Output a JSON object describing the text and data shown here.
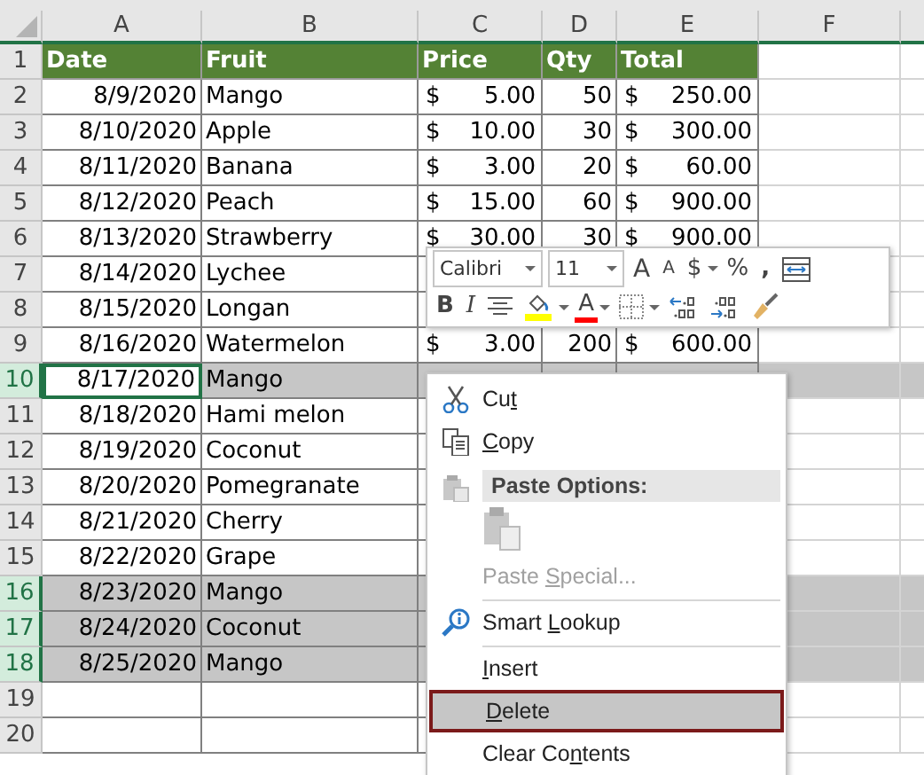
{
  "columns": [
    "A",
    "B",
    "C",
    "D",
    "E",
    "F"
  ],
  "header_row": {
    "number": "1",
    "cells": [
      "Date",
      "Fruit",
      "Price",
      "Qty",
      "Total"
    ]
  },
  "rows": [
    {
      "number": "2",
      "selected": false,
      "active": false,
      "date": "8/9/2020",
      "fruit": "Mango",
      "price_symbol": "$",
      "price": "5.00",
      "qty": "50",
      "total_symbol": "$",
      "total": "250.00"
    },
    {
      "number": "3",
      "selected": false,
      "active": false,
      "date": "8/10/2020",
      "fruit": "Apple",
      "price_symbol": "$",
      "price": "10.00",
      "qty": "30",
      "total_symbol": "$",
      "total": "300.00"
    },
    {
      "number": "4",
      "selected": false,
      "active": false,
      "date": "8/11/2020",
      "fruit": "Banana",
      "price_symbol": "$",
      "price": "3.00",
      "qty": "20",
      "total_symbol": "$",
      "total": "60.00"
    },
    {
      "number": "5",
      "selected": false,
      "active": false,
      "date": "8/12/2020",
      "fruit": "Peach",
      "price_symbol": "$",
      "price": "15.00",
      "qty": "60",
      "total_symbol": "$",
      "total": "900.00"
    },
    {
      "number": "6",
      "selected": false,
      "active": false,
      "date": "8/13/2020",
      "fruit": "Strawberry",
      "price_symbol": "$",
      "price": "30.00",
      "qty": "30",
      "total_symbol": "$",
      "total": "900.00"
    },
    {
      "number": "7",
      "selected": false,
      "active": false,
      "date": "8/14/2020",
      "fruit": "Lychee"
    },
    {
      "number": "8",
      "selected": false,
      "active": false,
      "date": "8/15/2020",
      "fruit": "Longan"
    },
    {
      "number": "9",
      "selected": false,
      "active": false,
      "date": "8/16/2020",
      "fruit": "Watermelon",
      "price_symbol": "$",
      "price": "3.00",
      "qty": "200",
      "total_symbol": "$",
      "total": "600.00"
    },
    {
      "number": "10",
      "selected": true,
      "active": true,
      "date": "8/17/2020",
      "fruit": "Mango"
    },
    {
      "number": "11",
      "selected": false,
      "active": false,
      "date": "8/18/2020",
      "fruit": "Hami melon"
    },
    {
      "number": "12",
      "selected": false,
      "active": false,
      "date": "8/19/2020",
      "fruit": "Coconut"
    },
    {
      "number": "13",
      "selected": false,
      "active": false,
      "date": "8/20/2020",
      "fruit": "Pomegranate"
    },
    {
      "number": "14",
      "selected": false,
      "active": false,
      "date": "8/21/2020",
      "fruit": "Cherry"
    },
    {
      "number": "15",
      "selected": false,
      "active": false,
      "date": "8/22/2020",
      "fruit": "Grape"
    },
    {
      "number": "16",
      "selected": true,
      "active": false,
      "date": "8/23/2020",
      "fruit": "Mango"
    },
    {
      "number": "17",
      "selected": true,
      "active": false,
      "date": "8/24/2020",
      "fruit": "Coconut"
    },
    {
      "number": "18",
      "selected": true,
      "active": false,
      "date": "8/25/2020",
      "fruit": "Mango"
    },
    {
      "number": "19",
      "selected": false,
      "active": false
    },
    {
      "number": "20",
      "selected": false,
      "active": false
    }
  ],
  "mini_toolbar": {
    "font": "Calibri",
    "size": "11",
    "grow_font": "A",
    "shrink_font": "A",
    "currency": "$",
    "percent": "%",
    "comma": ",",
    "bold": "B",
    "italic": "I",
    "font_color": "A"
  },
  "context_menu": [
    {
      "kind": "cut",
      "before": "Cu",
      "key": "t",
      "selected": false,
      "disabled": false
    },
    {
      "kind": "copy",
      "key": "C",
      "after": "opy",
      "selected": false,
      "disabled": false
    },
    {
      "kind": "header",
      "label": "Paste Options:"
    },
    {
      "kind": "paste-icons"
    },
    {
      "kind": "plain",
      "before": "Paste ",
      "key": "S",
      "after": "pecial...",
      "selected": false,
      "disabled": true
    },
    {
      "kind": "separator"
    },
    {
      "kind": "lookup",
      "before": "Smart ",
      "key": "L",
      "after": "ookup",
      "selected": false,
      "disabled": false
    },
    {
      "kind": "separator"
    },
    {
      "kind": "plain",
      "key": "I",
      "after": "nsert",
      "selected": false,
      "disabled": false
    },
    {
      "kind": "plain",
      "key": "D",
      "after": "elete",
      "selected": true,
      "disabled": false
    },
    {
      "kind": "plain",
      "before": "Clear Co",
      "key": "n",
      "after": "tents",
      "selected": false,
      "disabled": false
    }
  ]
}
